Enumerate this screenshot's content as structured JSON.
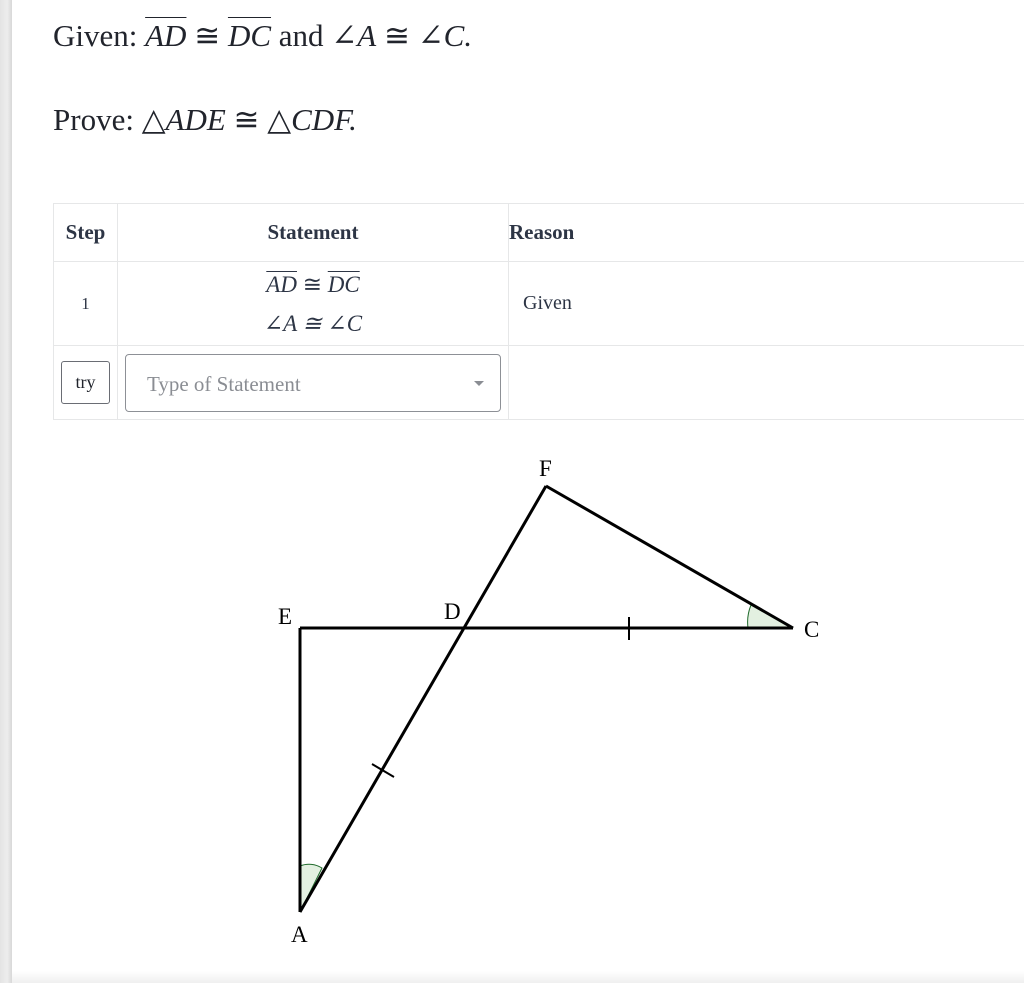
{
  "problem": {
    "given_prefix": "Given:",
    "given_seg1": "AD",
    "given_cong1": "≅",
    "given_seg2": "DC",
    "given_and": "and",
    "given_angle1": "∠A",
    "given_cong2": "≅",
    "given_angle2": "∠C.",
    "prove_prefix": "Prove:",
    "prove_tri1": "△ADE",
    "prove_cong": "≅",
    "prove_tri2": "△CDF."
  },
  "table": {
    "headers": {
      "step": "Step",
      "statement": "Statement",
      "reason": "Reason"
    },
    "rows": [
      {
        "step": "1",
        "statement_line1_seg1": "AD",
        "statement_line1_cong": "≅",
        "statement_line1_seg2": "DC",
        "statement_line2": "∠A ≅ ∠C",
        "reason": "Given"
      }
    ],
    "input_row": {
      "try_label": "try",
      "statement_placeholder": "Type of Statement"
    }
  },
  "figure": {
    "labels": {
      "F": "F",
      "E": "E",
      "D": "D",
      "C": "C",
      "A": "A"
    }
  }
}
